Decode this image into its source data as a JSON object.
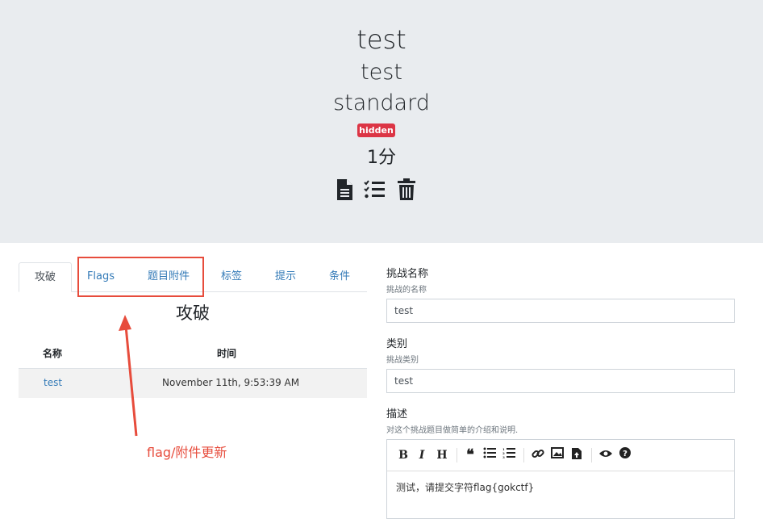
{
  "header": {
    "title": "test",
    "category": "test",
    "type": "standard",
    "badge": "hidden",
    "points": "1分",
    "actions": [
      "file-icon",
      "checklist-icon",
      "trash-icon"
    ]
  },
  "tabs": [
    "攻破",
    "Flags",
    "题目附件",
    "标签",
    "提示",
    "条件"
  ],
  "solves": {
    "title": "攻破",
    "columns": [
      "名称",
      "时间"
    ],
    "rows": [
      {
        "name": "test",
        "time": "November 11th, 9:53:39 AM"
      }
    ]
  },
  "annotation": "flag/附件更新",
  "form": {
    "name_label": "挑战名称",
    "name_hint": "挑战的名称",
    "name_value": "test",
    "category_label": "类别",
    "category_hint": "挑战类别",
    "category_value": "test",
    "desc_label": "描述",
    "desc_hint": "对这个挑战题目做简单的介绍和说明.",
    "desc_value": "测试，请提交字符flag{gokctf}",
    "toolbar": [
      "bold",
      "italic",
      "heading",
      "quote",
      "unordered-list",
      "ordered-list",
      "link",
      "image",
      "upload",
      "preview",
      "guide"
    ]
  },
  "colors": {
    "badge": "#dc3545",
    "link": "#337ab7",
    "annotation": "#e74c3c",
    "header_bg": "#e9ecef"
  }
}
